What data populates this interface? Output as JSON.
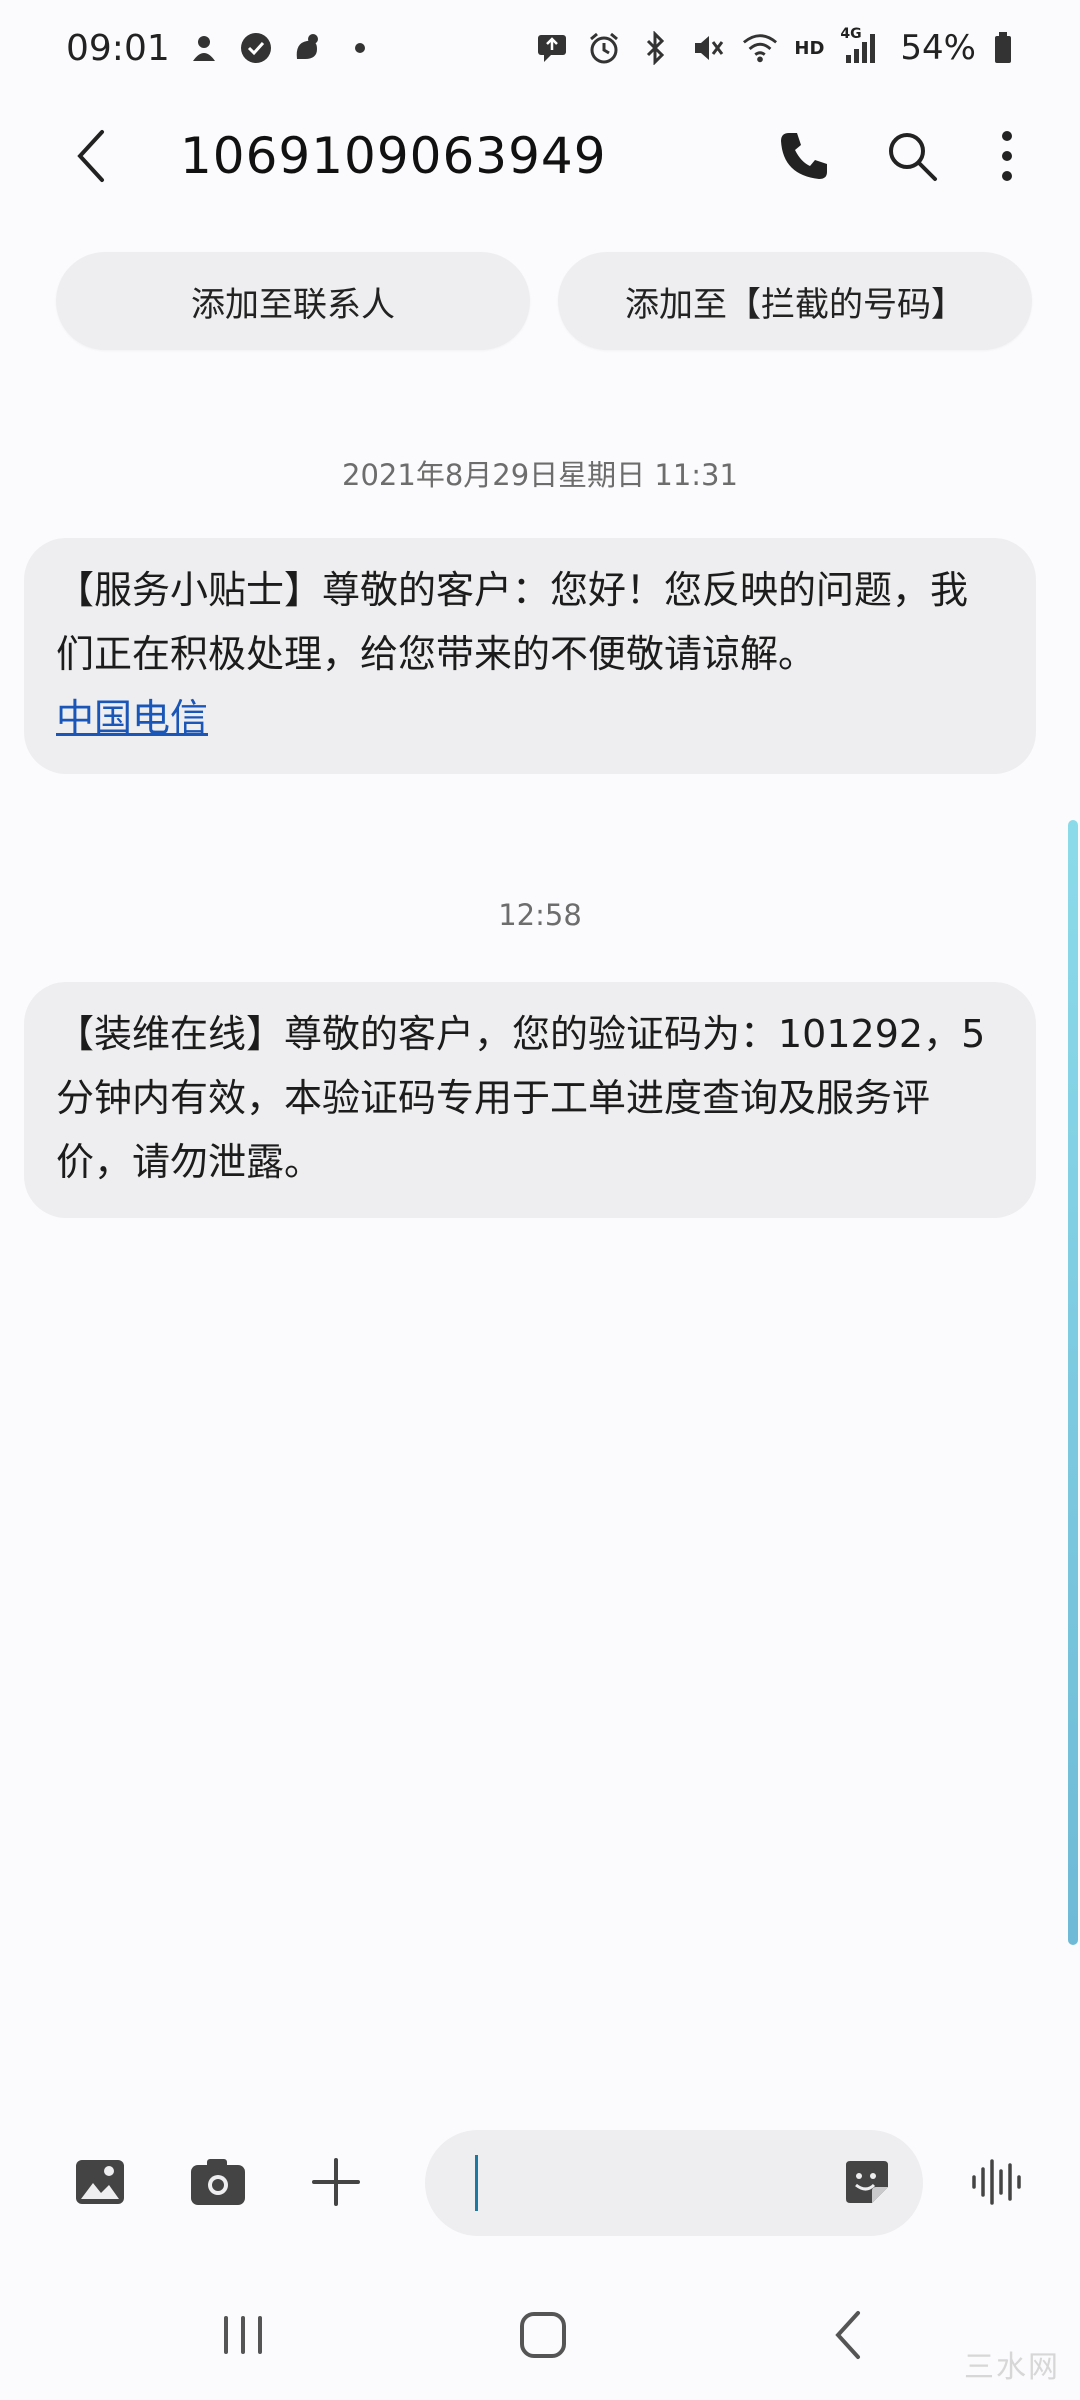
{
  "status_bar": {
    "time": "09:01",
    "left_icons": [
      "notification-icon",
      "check-badge-icon",
      "squirrel-icon",
      "dot-icon"
    ],
    "right_icons": [
      "sms-icon",
      "alarm-icon",
      "bluetooth-icon",
      "mute-icon",
      "wifi-icon",
      "hd-icon",
      "signal-4g-icon",
      "battery-icon"
    ],
    "network_hd": "HD",
    "network_4g": "4G",
    "battery_percent": "54%"
  },
  "header": {
    "title": "1069109063949"
  },
  "actions": {
    "add_contact": "添加至联系人",
    "add_block": "添加至【拦截的号码】"
  },
  "messages": [
    {
      "timestamp": "2021年8月29日星期日 11:31",
      "text": "【服务小贴士】尊敬的客户：您好！您反映的问题，我们正在积极处理，给您带来的不便敬请谅解。",
      "link": "中国电信"
    },
    {
      "timestamp": "12:58",
      "text": "【装维在线】尊敬的客户，您的验证码为：101292，5分钟内有效，本验证码专用于工单进度查询及服务评价，请勿泄露。"
    }
  ],
  "composer": {
    "placeholder": "",
    "value": ""
  },
  "colors": {
    "bubble_bg": "#eeeef0",
    "link": "#1a56b8",
    "caret": "#1c7aa0",
    "scrollbar": "#6cc6de"
  },
  "watermark": "三水网"
}
